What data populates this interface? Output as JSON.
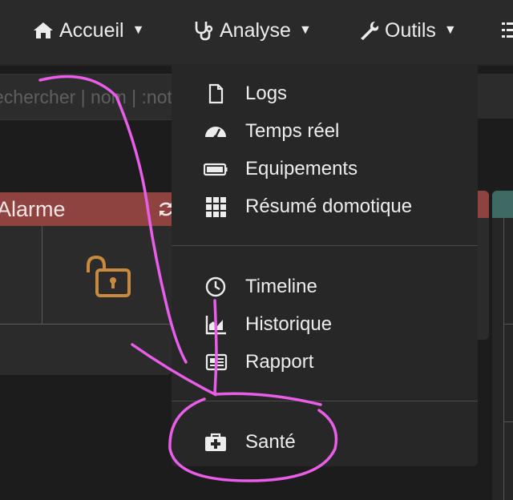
{
  "navbar": {
    "items": [
      {
        "label": "Accueil",
        "icon": "home-icon"
      },
      {
        "label": "Analyse",
        "icon": "stethoscope-icon"
      },
      {
        "label": "Outils",
        "icon": "wrench-icon"
      }
    ]
  },
  "search": {
    "placeholder": "echercher | nom | :not"
  },
  "widget": {
    "title": "Alarme"
  },
  "dropdown": {
    "groups": [
      [
        {
          "label": "Logs",
          "icon": "file-icon"
        },
        {
          "label": "Temps réel",
          "icon": "dashboard-gauge-icon"
        },
        {
          "label": "Equipements",
          "icon": "battery-icon"
        },
        {
          "label": "Résumé domotique",
          "icon": "grid-icon"
        }
      ],
      [
        {
          "label": "Timeline",
          "icon": "clock-icon"
        },
        {
          "label": "Historique",
          "icon": "chart-area-icon"
        },
        {
          "label": "Rapport",
          "icon": "newspaper-icon"
        }
      ],
      [
        {
          "label": "Santé",
          "icon": "medkit-icon"
        }
      ]
    ]
  },
  "colors": {
    "background": "#1c1c1c",
    "navbar": "#2a2a2a",
    "dropdown": "#272727",
    "alarm_header": "#8f4340",
    "lock_icon": "#c98a3e",
    "annotation": "#e85ee8"
  }
}
